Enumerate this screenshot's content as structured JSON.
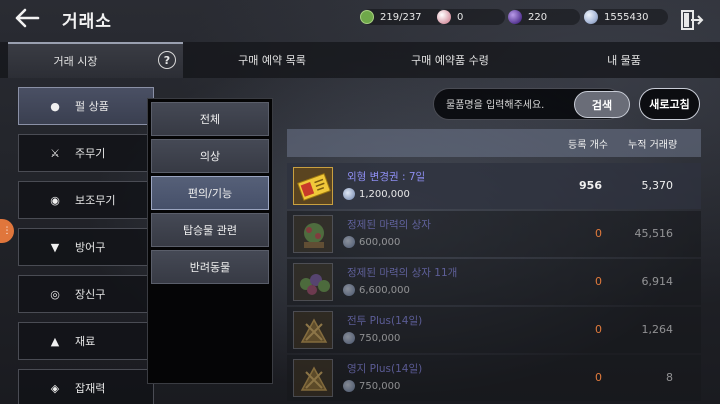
{
  "header": {
    "title": "거래소",
    "currencies": [
      {
        "icon": "energy-icon",
        "value": "219/237",
        "color": "#6fa84a"
      },
      {
        "icon": "pearl-icon",
        "value": "0",
        "color": "#d89aa8"
      },
      {
        "icon": "crystal-icon",
        "value": "220",
        "color": "#6a3fb0"
      },
      {
        "icon": "silver-coin-icon",
        "value": "1555430",
        "color": "#a8b8d8"
      }
    ]
  },
  "tabs": [
    {
      "label": "거래 시장",
      "active": true
    },
    {
      "label": "구매 예약 목록",
      "active": false
    },
    {
      "label": "구매 예약품 수령",
      "active": false
    },
    {
      "label": "내 물품",
      "active": false
    }
  ],
  "help_label": "?",
  "categories": [
    {
      "icon": "pearl-item-icon",
      "label": "펄 상품",
      "glyph": "●",
      "active": true
    },
    {
      "icon": "main-weapon-icon",
      "label": "주무기",
      "glyph": "⚔",
      "active": false
    },
    {
      "icon": "sub-weapon-icon",
      "label": "보조무기",
      "glyph": "◉",
      "active": false
    },
    {
      "icon": "armor-icon",
      "label": "방어구",
      "glyph": "▼",
      "active": false
    },
    {
      "icon": "accessory-icon",
      "label": "장신구",
      "glyph": "◎",
      "active": false
    },
    {
      "icon": "material-icon",
      "label": "재료",
      "glyph": "▲",
      "active": false
    },
    {
      "icon": "misc-icon",
      "label": "잡재력",
      "glyph": "◈",
      "active": false
    }
  ],
  "subcategories": [
    {
      "label": "전체",
      "active": false
    },
    {
      "label": "의상",
      "active": false
    },
    {
      "label": "편의/기능",
      "active": true
    },
    {
      "label": "탑승물 관련",
      "active": false
    },
    {
      "label": "반려동물",
      "active": false
    }
  ],
  "search": {
    "placeholder": "물품명을 입력해주세요.",
    "button_label": "검색"
  },
  "refresh_label": "새로고침",
  "table": {
    "headers": {
      "count": "등록 개수",
      "volume": "누적 거래량"
    },
    "rows": [
      {
        "name": "외형 변경권 : 7일",
        "price": "1,200,000",
        "count": "956",
        "volume": "5,370",
        "thumb": "ticket"
      },
      {
        "name": "정제된 마력의 상자",
        "price": "600,000",
        "count": "0",
        "volume": "45,516",
        "thumb": "box"
      },
      {
        "name": "정제된 마력의 상자 11개",
        "price": "6,600,000",
        "count": "0",
        "volume": "6,914",
        "thumb": "boxes"
      },
      {
        "name": "전투 Plus(14일)",
        "price": "750,000",
        "count": "0",
        "volume": "1,264",
        "thumb": "plus"
      },
      {
        "name": "영지 Plus(14일)",
        "price": "750,000",
        "count": "0",
        "volume": "8",
        "thumb": "plus"
      }
    ]
  }
}
